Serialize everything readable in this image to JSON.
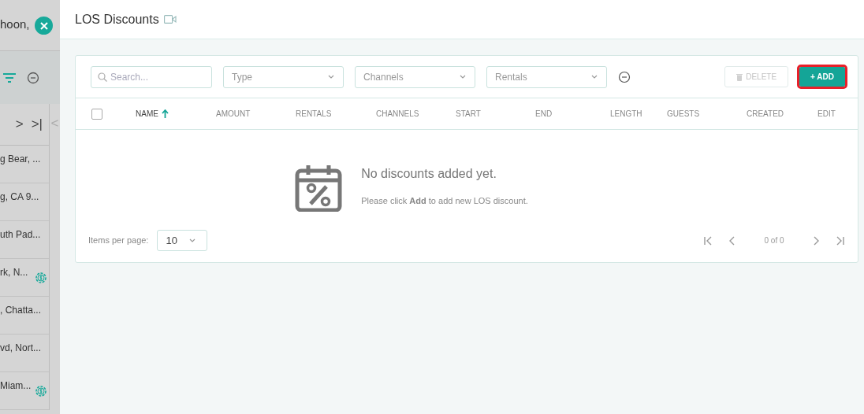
{
  "background": {
    "header_text": "hoon,",
    "rows": [
      {
        "text": "g Bear, ...",
        "badge": false
      },
      {
        "text": "g, CA 9...",
        "badge": false
      },
      {
        "text": "uth Pad...",
        "badge": false
      },
      {
        "text": "rk, N...",
        "badge": true
      },
      {
        "text": ", Chatta...",
        "badge": false
      },
      {
        "text": "vd, Nort...",
        "badge": false
      },
      {
        "text": "Miam...",
        "badge": true
      }
    ],
    "pager": [
      ">",
      ">|"
    ],
    "side_pager": "<"
  },
  "dialog": {
    "title": "LOS Discounts",
    "filters": {
      "search": {
        "placeholder": "Search..."
      },
      "selects": [
        "Type",
        "Channels",
        "Rentals"
      ]
    },
    "buttons": [
      {
        "label": "DELETE",
        "disabled": true
      },
      {
        "label": "+ ADD",
        "disabled": false,
        "highlighted": true
      }
    ],
    "table": {
      "columns": [
        {
          "label": "NAME",
          "sorted": true
        },
        {
          "label": "AMOUNT",
          "sorted": false
        },
        {
          "label": "RENTALS",
          "sorted": false
        },
        {
          "label": "CHANNELS",
          "sorted": false
        },
        {
          "label": "START",
          "sorted": false
        },
        {
          "label": "END",
          "sorted": false
        },
        {
          "label": "LENGTH",
          "sorted": false
        },
        {
          "label": "GUESTS",
          "sorted": false
        },
        {
          "label": "CREATED",
          "sorted": false
        },
        {
          "label": "EDIT",
          "sorted": false
        }
      ],
      "select_all": {
        "checked": false
      },
      "empty": {
        "title": "No discounts added yet.",
        "message": "Please click **Add** to add new LOS discount."
      }
    },
    "footer": {
      "items_per_page_label": "Items per page:",
      "items_per_page": "10",
      "range": "0 of 0"
    }
  }
}
